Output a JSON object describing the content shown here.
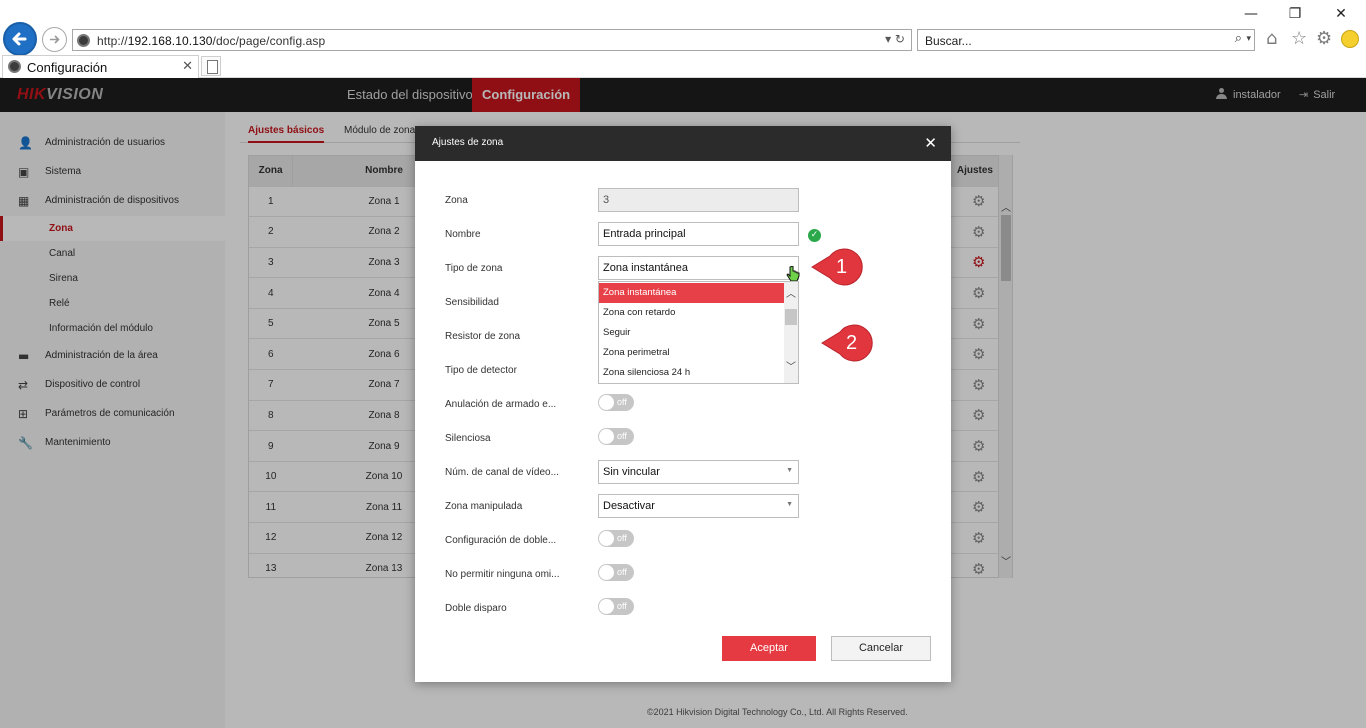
{
  "browser": {
    "url_prefix": "http://",
    "url_host": "192.168.10.130",
    "url_path": "/doc/page/config.asp",
    "search_placeholder": "Buscar...",
    "tab_title": "Configuración",
    "icons": [
      "back-icon",
      "forward-icon",
      "refresh-icon",
      "search-icon",
      "home-icon",
      "star-icon",
      "gear-icon",
      "smiley-icon"
    ]
  },
  "header": {
    "logo_prefix": "HIK",
    "logo_rest": "VISION",
    "nav": [
      "Estado del dispositivo",
      "Configuración"
    ],
    "user": "instalador",
    "logout": "Salir",
    "accent_color": "#c8161d"
  },
  "sidebar": {
    "items": [
      {
        "label": "Administración de usuarios",
        "icon": "user-icon"
      },
      {
        "label": "Sistema",
        "icon": "system-icon"
      },
      {
        "label": "Administración de dispositivos",
        "icon": "devices-icon"
      },
      {
        "label": "Administración de la área",
        "icon": "area-icon"
      },
      {
        "label": "Dispositivo de control",
        "icon": "control-icon"
      },
      {
        "label": "Parámetros de comunicación",
        "icon": "network-icon"
      },
      {
        "label": "Mantenimiento",
        "icon": "wrench-icon"
      }
    ],
    "subitems": [
      "Zona",
      "Canal",
      "Sirena",
      "Relé",
      "Información del módulo"
    ],
    "active_subitem": "Zona"
  },
  "main": {
    "subtabs": [
      "Ajustes básicos",
      "Módulo de zona"
    ],
    "columns": [
      "Zona",
      "Nombre",
      "Ajustes"
    ],
    "rows": [
      {
        "num": "1",
        "name": "Zona 1"
      },
      {
        "num": "2",
        "name": "Zona 2"
      },
      {
        "num": "3",
        "name": "Zona 3"
      },
      {
        "num": "4",
        "name": "Zona 4"
      },
      {
        "num": "5",
        "name": "Zona 5"
      },
      {
        "num": "6",
        "name": "Zona 6"
      },
      {
        "num": "7",
        "name": "Zona 7"
      },
      {
        "num": "8",
        "name": "Zona 8"
      },
      {
        "num": "9",
        "name": "Zona 9"
      },
      {
        "num": "10",
        "name": "Zona 10"
      },
      {
        "num": "11",
        "name": "Zona 11"
      },
      {
        "num": "12",
        "name": "Zona 12"
      },
      {
        "num": "13",
        "name": "Zona 13"
      }
    ],
    "active_row": "3",
    "footer": "©2021 Hikvision Digital Technology Co., Ltd. All Rights Reserved."
  },
  "modal": {
    "title": "Ajustes de zona",
    "fields": {
      "zona_label": "Zona",
      "zona_value": "3",
      "nombre_label": "Nombre",
      "nombre_value": "Entrada principal",
      "tipo_label": "Tipo de zona",
      "tipo_value": "Zona instantánea",
      "sensibilidad_label": "Sensibilidad",
      "resistor_label": "Resistor de zona",
      "detector_label": "Tipo de detector",
      "anulacion_label": "Anulación de armado e...",
      "silenciosa_label": "Silenciosa",
      "canal_label": "Núm. de canal de vídeo...",
      "canal_value": "Sin vincular",
      "manipulada_label": "Zona manipulada",
      "manipulada_value": "Desactivar",
      "doble_cfg_label": "Configuración de doble...",
      "no_omit_label": "No permitir ninguna omi...",
      "doble_disparo_label": "Doble disparo"
    },
    "toggle_off": "off",
    "dropdown_options": [
      "Zona instantánea",
      "Zona con retardo",
      "Seguir",
      "Zona perimetral",
      "Zona silenciosa 24 h"
    ],
    "selected_option": "Zona instantánea",
    "ok_label": "Aceptar",
    "cancel_label": "Cancelar"
  },
  "callouts": [
    "1",
    "2"
  ]
}
